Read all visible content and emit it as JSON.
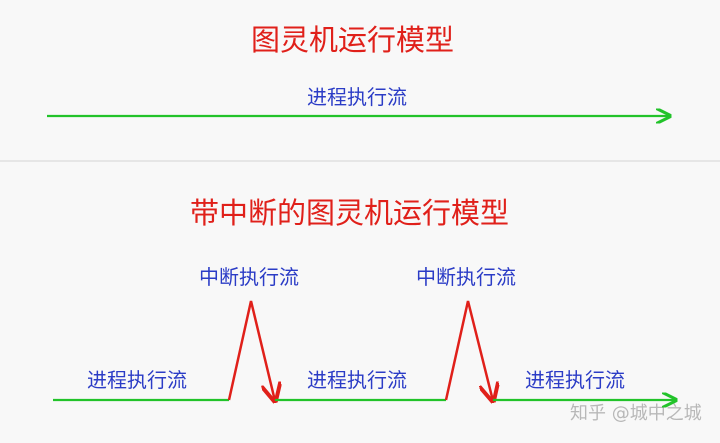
{
  "top_model": {
    "title": "图灵机运行模型",
    "flow_label": "进程执行流"
  },
  "bottom_model": {
    "title": "带中断的图灵机运行模型",
    "process_labels": [
      "进程执行流",
      "进程执行流",
      "进程执行流"
    ],
    "interrupt_labels": [
      "中断执行流",
      "中断执行流"
    ]
  },
  "watermark": "知乎 @城中之城",
  "colors": {
    "title": "#e0201a",
    "label": "#2b3cc6",
    "process_flow": "#22c32a",
    "interrupt_flow": "#e0201a",
    "background": "#f8f8f8",
    "divider": "#e6e6e6"
  }
}
